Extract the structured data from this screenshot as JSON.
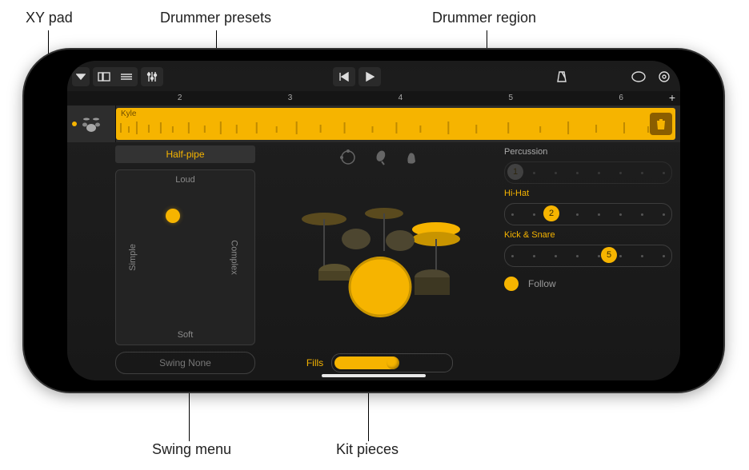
{
  "callouts": {
    "xy_pad": "XY pad",
    "drummer_presets": "Drummer presets",
    "drummer_region": "Drummer region",
    "swing_menu": "Swing menu",
    "kit_pieces": "Kit pieces"
  },
  "ruler": {
    "m2": "2",
    "m3": "3",
    "m4": "4",
    "m5": "5",
    "m6": "6"
  },
  "track": {
    "name": "Kyle"
  },
  "preset": {
    "name": "Half-pipe"
  },
  "xy": {
    "top": "Loud",
    "bottom": "Soft",
    "left": "Simple",
    "right": "Complex"
  },
  "swing": {
    "label": "Swing None"
  },
  "fills": {
    "label": "Fills"
  },
  "params": {
    "percussion": {
      "label": "Percussion",
      "value": "1"
    },
    "hihat": {
      "label": "Hi-Hat",
      "value": "2"
    },
    "kicksnare": {
      "label": "Kick & Snare",
      "value": "5"
    }
  },
  "follow": {
    "label": "Follow"
  },
  "icons": {
    "menu": "menu-triangle",
    "view1": "browser-view",
    "tracks_view": "tracks-view",
    "mixer": "mixer-sliders",
    "prev": "skip-back",
    "play": "play",
    "metronome": "metronome",
    "loop": "loop",
    "settings": "gear",
    "plus": "plus",
    "trash": "trash",
    "tambourine": "tambourine",
    "shaker": "shaker",
    "handclap": "handclap"
  }
}
